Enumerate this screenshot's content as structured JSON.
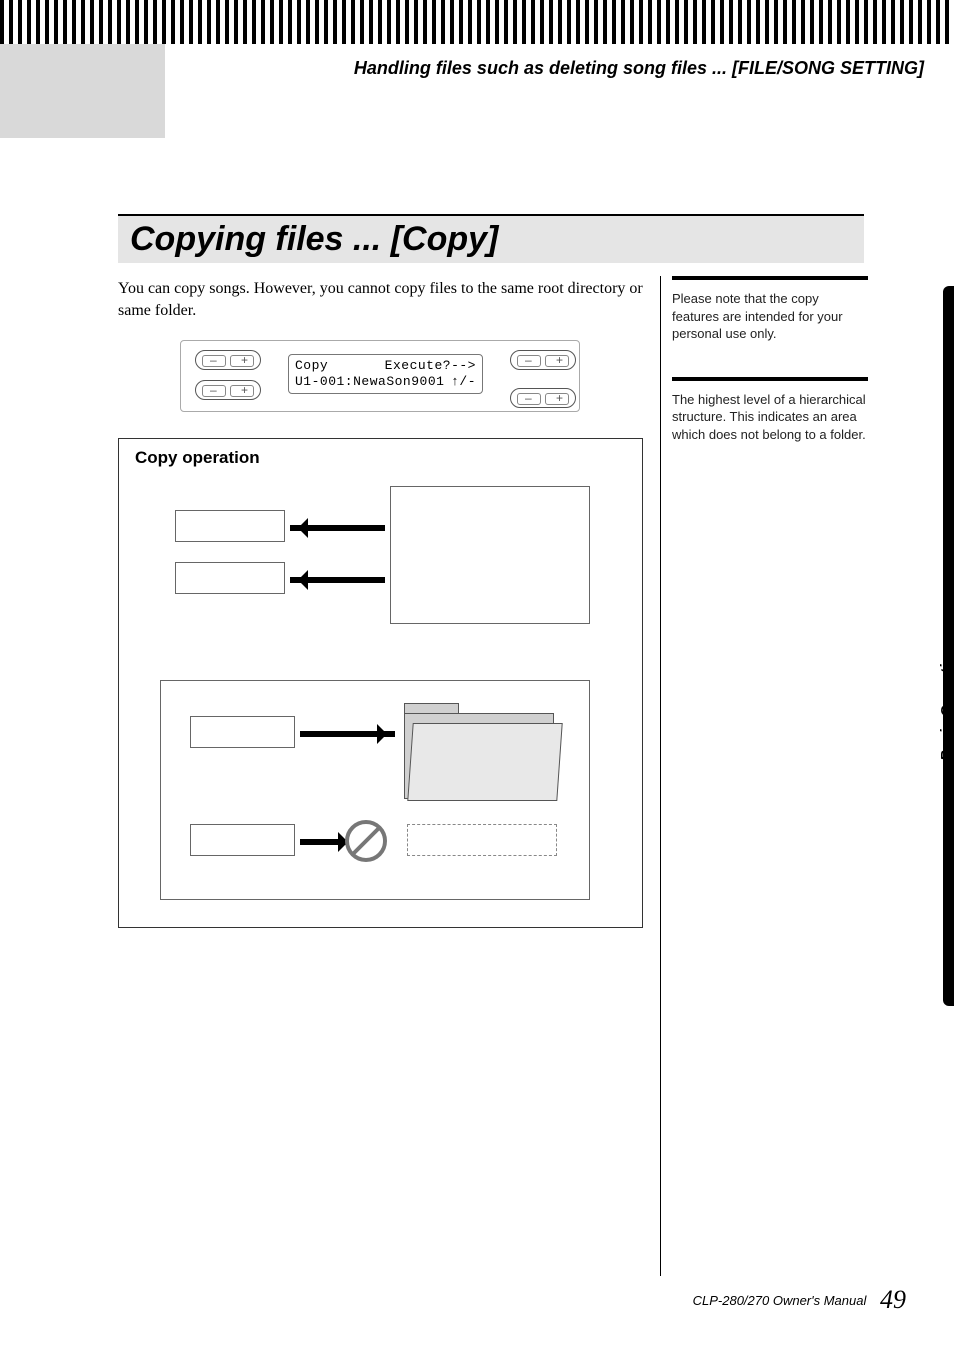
{
  "header": "Handling files such as deleting song files ... [FILE/SONG SETTING]",
  "section_title": "Copying files ... [Copy]",
  "intro": "You can copy songs. However, you cannot copy files to the same root directory or same folder.",
  "lcd": {
    "r1a": "Copy",
    "r1b": "Execute?-->",
    "r2a": "U1-001:NewaSon9001",
    "r2b": "↑/-"
  },
  "copybox_title": "Copy operation",
  "sidebar": {
    "note1": "Please note that the copy features are intended for your personal use only.",
    "note2": "The highest level of a hierarchical structure. This indicates an area which does not belong to a folder."
  },
  "tab_label": "Basic Operation",
  "footer_text": "CLP-280/270 Owner's Manual",
  "page_number": "49"
}
